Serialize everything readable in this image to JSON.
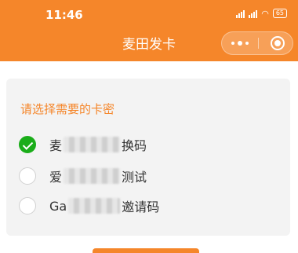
{
  "status_bar": {
    "time": "11:46",
    "battery": "65",
    "signal_icons": [
      "signal-icon",
      "signal-icon"
    ],
    "wifi_icon": "wifi-icon"
  },
  "header": {
    "title": "麦田发卡",
    "background_color": "#f5862a",
    "more_icon": "more-dots-icon",
    "close_icon": "target-close-icon"
  },
  "card": {
    "title": "请选择需要的卡密",
    "accent_color": "#f5862a",
    "options": [
      {
        "prefix": "麦",
        "suffix": "换码",
        "selected": true
      },
      {
        "prefix": "爱",
        "suffix": "测试",
        "selected": false
      },
      {
        "prefix": "Ga",
        "suffix": "邀请码",
        "selected": false
      }
    ]
  },
  "selected_color": "#1aad19"
}
